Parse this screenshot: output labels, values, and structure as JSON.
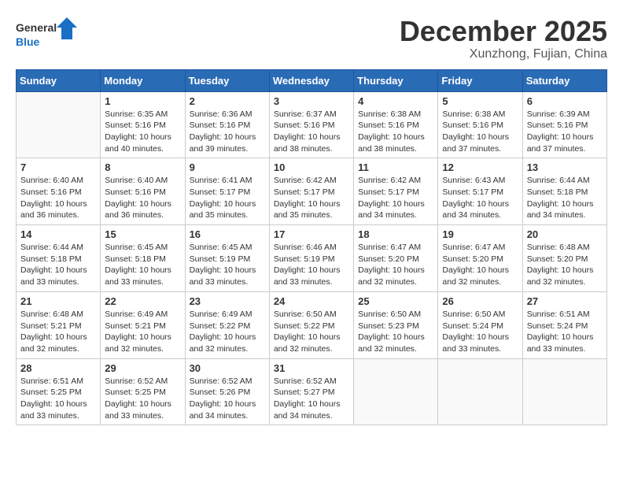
{
  "header": {
    "logo_general": "General",
    "logo_blue": "Blue",
    "month_title": "December 2025",
    "location": "Xunzhong, Fujian, China"
  },
  "weekdays": [
    "Sunday",
    "Monday",
    "Tuesday",
    "Wednesday",
    "Thursday",
    "Friday",
    "Saturday"
  ],
  "weeks": [
    [
      {
        "day": "",
        "info": ""
      },
      {
        "day": "1",
        "info": "Sunrise: 6:35 AM\nSunset: 5:16 PM\nDaylight: 10 hours and 40 minutes."
      },
      {
        "day": "2",
        "info": "Sunrise: 6:36 AM\nSunset: 5:16 PM\nDaylight: 10 hours and 39 minutes."
      },
      {
        "day": "3",
        "info": "Sunrise: 6:37 AM\nSunset: 5:16 PM\nDaylight: 10 hours and 38 minutes."
      },
      {
        "day": "4",
        "info": "Sunrise: 6:38 AM\nSunset: 5:16 PM\nDaylight: 10 hours and 38 minutes."
      },
      {
        "day": "5",
        "info": "Sunrise: 6:38 AM\nSunset: 5:16 PM\nDaylight: 10 hours and 37 minutes."
      },
      {
        "day": "6",
        "info": "Sunrise: 6:39 AM\nSunset: 5:16 PM\nDaylight: 10 hours and 37 minutes."
      }
    ],
    [
      {
        "day": "7",
        "info": "Sunrise: 6:40 AM\nSunset: 5:16 PM\nDaylight: 10 hours and 36 minutes."
      },
      {
        "day": "8",
        "info": "Sunrise: 6:40 AM\nSunset: 5:16 PM\nDaylight: 10 hours and 36 minutes."
      },
      {
        "day": "9",
        "info": "Sunrise: 6:41 AM\nSunset: 5:17 PM\nDaylight: 10 hours and 35 minutes."
      },
      {
        "day": "10",
        "info": "Sunrise: 6:42 AM\nSunset: 5:17 PM\nDaylight: 10 hours and 35 minutes."
      },
      {
        "day": "11",
        "info": "Sunrise: 6:42 AM\nSunset: 5:17 PM\nDaylight: 10 hours and 34 minutes."
      },
      {
        "day": "12",
        "info": "Sunrise: 6:43 AM\nSunset: 5:17 PM\nDaylight: 10 hours and 34 minutes."
      },
      {
        "day": "13",
        "info": "Sunrise: 6:44 AM\nSunset: 5:18 PM\nDaylight: 10 hours and 34 minutes."
      }
    ],
    [
      {
        "day": "14",
        "info": "Sunrise: 6:44 AM\nSunset: 5:18 PM\nDaylight: 10 hours and 33 minutes."
      },
      {
        "day": "15",
        "info": "Sunrise: 6:45 AM\nSunset: 5:18 PM\nDaylight: 10 hours and 33 minutes."
      },
      {
        "day": "16",
        "info": "Sunrise: 6:45 AM\nSunset: 5:19 PM\nDaylight: 10 hours and 33 minutes."
      },
      {
        "day": "17",
        "info": "Sunrise: 6:46 AM\nSunset: 5:19 PM\nDaylight: 10 hours and 33 minutes."
      },
      {
        "day": "18",
        "info": "Sunrise: 6:47 AM\nSunset: 5:20 PM\nDaylight: 10 hours and 32 minutes."
      },
      {
        "day": "19",
        "info": "Sunrise: 6:47 AM\nSunset: 5:20 PM\nDaylight: 10 hours and 32 minutes."
      },
      {
        "day": "20",
        "info": "Sunrise: 6:48 AM\nSunset: 5:20 PM\nDaylight: 10 hours and 32 minutes."
      }
    ],
    [
      {
        "day": "21",
        "info": "Sunrise: 6:48 AM\nSunset: 5:21 PM\nDaylight: 10 hours and 32 minutes."
      },
      {
        "day": "22",
        "info": "Sunrise: 6:49 AM\nSunset: 5:21 PM\nDaylight: 10 hours and 32 minutes."
      },
      {
        "day": "23",
        "info": "Sunrise: 6:49 AM\nSunset: 5:22 PM\nDaylight: 10 hours and 32 minutes."
      },
      {
        "day": "24",
        "info": "Sunrise: 6:50 AM\nSunset: 5:22 PM\nDaylight: 10 hours and 32 minutes."
      },
      {
        "day": "25",
        "info": "Sunrise: 6:50 AM\nSunset: 5:23 PM\nDaylight: 10 hours and 32 minutes."
      },
      {
        "day": "26",
        "info": "Sunrise: 6:50 AM\nSunset: 5:24 PM\nDaylight: 10 hours and 33 minutes."
      },
      {
        "day": "27",
        "info": "Sunrise: 6:51 AM\nSunset: 5:24 PM\nDaylight: 10 hours and 33 minutes."
      }
    ],
    [
      {
        "day": "28",
        "info": "Sunrise: 6:51 AM\nSunset: 5:25 PM\nDaylight: 10 hours and 33 minutes."
      },
      {
        "day": "29",
        "info": "Sunrise: 6:52 AM\nSunset: 5:25 PM\nDaylight: 10 hours and 33 minutes."
      },
      {
        "day": "30",
        "info": "Sunrise: 6:52 AM\nSunset: 5:26 PM\nDaylight: 10 hours and 34 minutes."
      },
      {
        "day": "31",
        "info": "Sunrise: 6:52 AM\nSunset: 5:27 PM\nDaylight: 10 hours and 34 minutes."
      },
      {
        "day": "",
        "info": ""
      },
      {
        "day": "",
        "info": ""
      },
      {
        "day": "",
        "info": ""
      }
    ]
  ]
}
